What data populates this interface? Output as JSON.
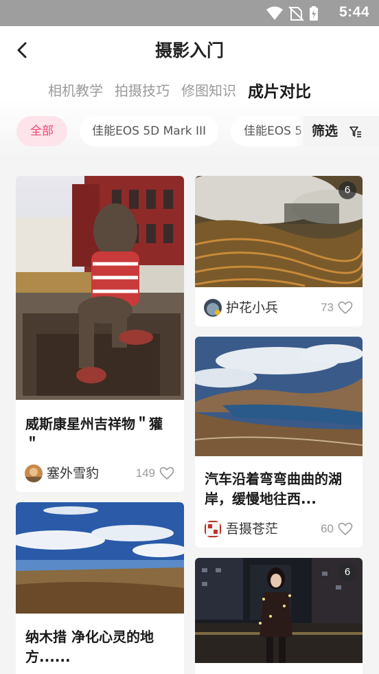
{
  "status_bar": {
    "time": "5:44",
    "icons": [
      "wifi-icon",
      "no-sim-icon",
      "battery-charging-icon"
    ]
  },
  "header": {
    "title": "摄影入门",
    "back_icon": "chevron-left-icon"
  },
  "tabs": [
    {
      "label": "相机教学",
      "active": false
    },
    {
      "label": "拍摄技巧",
      "active": false
    },
    {
      "label": "修图知识",
      "active": false
    },
    {
      "label": "成片对比",
      "active": true
    }
  ],
  "chips": [
    {
      "label": "全部",
      "active": true
    },
    {
      "label": "佳能EOS 5D Mark III",
      "active": false
    },
    {
      "label": "佳能EOS 5",
      "active": false
    }
  ],
  "filter": {
    "label": "筛选",
    "icon": "filter-icon"
  },
  "accent_color": "#ef4670",
  "cards": [
    {
      "title": "威斯康星州吉祥物＂獾＂",
      "author": "塞外雪豹",
      "likes": "149"
    },
    {
      "title": "",
      "author": "护花小兵",
      "likes": "73",
      "badge": "6"
    },
    {
      "title": "汽车沿着弯弯曲曲的湖岸，缓慢地往西...",
      "author": "吾摄苍茫",
      "likes": "60"
    },
    {
      "title": "纳木措  净化心灵的地方......",
      "author": "",
      "likes": ""
    },
    {
      "title": "",
      "author": "",
      "likes": "",
      "badge": "6"
    }
  ]
}
